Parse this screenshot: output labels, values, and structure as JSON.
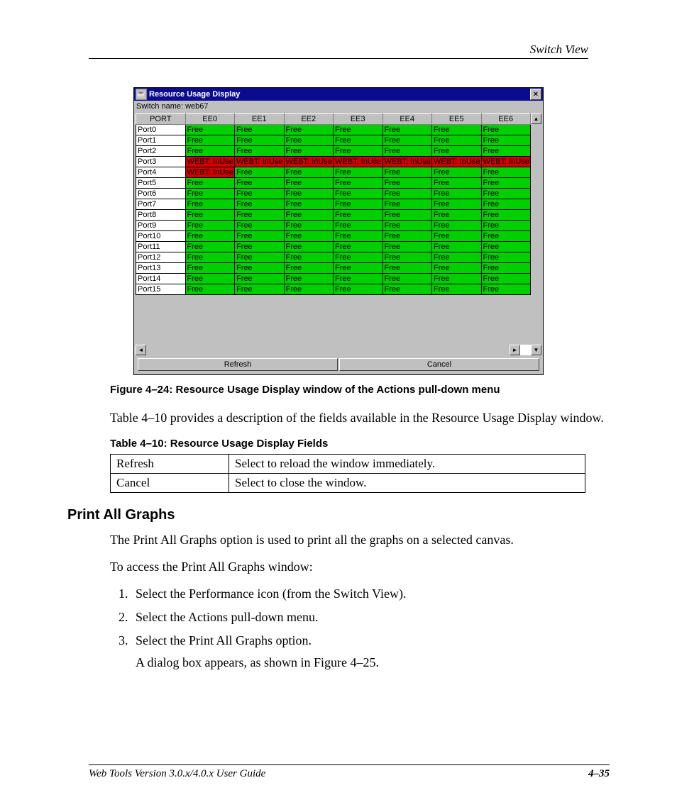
{
  "header": {
    "section": "Switch View"
  },
  "window": {
    "title": "Resource Usage Display",
    "switch_line": "Switch name: web67",
    "columns": [
      "PORT",
      "EE0",
      "EE1",
      "EE2",
      "EE3",
      "EE4",
      "EE5",
      "EE6"
    ],
    "free_label": "Free",
    "inuse_label": "WEBT: InUse",
    "rows": [
      {
        "port": "Port0",
        "cells": [
          "free",
          "free",
          "free",
          "free",
          "free",
          "free",
          "free"
        ]
      },
      {
        "port": "Port1",
        "cells": [
          "free",
          "free",
          "free",
          "free",
          "free",
          "free",
          "free"
        ]
      },
      {
        "port": "Port2",
        "cells": [
          "free",
          "free",
          "free",
          "free",
          "free",
          "free",
          "free"
        ]
      },
      {
        "port": "Port3",
        "cells": [
          "inuse",
          "inuse",
          "inuse",
          "inuse",
          "inuse",
          "inuse",
          "inuse"
        ]
      },
      {
        "port": "Port4",
        "cells": [
          "inuse",
          "free",
          "free",
          "free",
          "free",
          "free",
          "free"
        ]
      },
      {
        "port": "Port5",
        "cells": [
          "free",
          "free",
          "free",
          "free",
          "free",
          "free",
          "free"
        ]
      },
      {
        "port": "Port6",
        "cells": [
          "free",
          "free",
          "free",
          "free",
          "free",
          "free",
          "free"
        ]
      },
      {
        "port": "Port7",
        "cells": [
          "free",
          "free",
          "free",
          "free",
          "free",
          "free",
          "free"
        ]
      },
      {
        "port": "Port8",
        "cells": [
          "free",
          "free",
          "free",
          "free",
          "free",
          "free",
          "free"
        ]
      },
      {
        "port": "Port9",
        "cells": [
          "free",
          "free",
          "free",
          "free",
          "free",
          "free",
          "free"
        ]
      },
      {
        "port": "Port10",
        "cells": [
          "free",
          "free",
          "free",
          "free",
          "free",
          "free",
          "free"
        ]
      },
      {
        "port": "Port11",
        "cells": [
          "free",
          "free",
          "free",
          "free",
          "free",
          "free",
          "free"
        ]
      },
      {
        "port": "Port12",
        "cells": [
          "free",
          "free",
          "free",
          "free",
          "free",
          "free",
          "free"
        ]
      },
      {
        "port": "Port13",
        "cells": [
          "free",
          "free",
          "free",
          "free",
          "free",
          "free",
          "free"
        ]
      },
      {
        "port": "Port14",
        "cells": [
          "free",
          "free",
          "free",
          "free",
          "free",
          "free",
          "free"
        ]
      },
      {
        "port": "Port15",
        "cells": [
          "free",
          "free",
          "free",
          "free",
          "free",
          "free",
          "free"
        ]
      }
    ],
    "refresh_label": "Refresh",
    "cancel_label": "Cancel"
  },
  "figure_caption": "Figure 4–24:  Resource Usage Display window of the Actions pull-down menu",
  "para_intro": "Table 4–10 provides a description of the fields available in the Resource Usage Display window.",
  "table_caption": "Table 4–10:  Resource Usage Display Fields",
  "doc_table": [
    {
      "field": "Refresh",
      "desc": "Select to reload the window immediately."
    },
    {
      "field": "Cancel",
      "desc": "Select to close the window."
    }
  ],
  "section_heading": "Print All Graphs",
  "para2": "The Print All Graphs option is used to print all the graphs on a selected canvas.",
  "para3": "To access the Print All Graphs window:",
  "steps": [
    "Select the Performance icon (from the Switch View).",
    "Select the Actions pull-down menu.",
    "Select the Print All Graphs option."
  ],
  "step3_follow": "A dialog box appears, as shown in Figure 4–25.",
  "footer": {
    "left": "Web Tools Version 3.0.x/4.0.x User Guide",
    "right": "4–35"
  }
}
